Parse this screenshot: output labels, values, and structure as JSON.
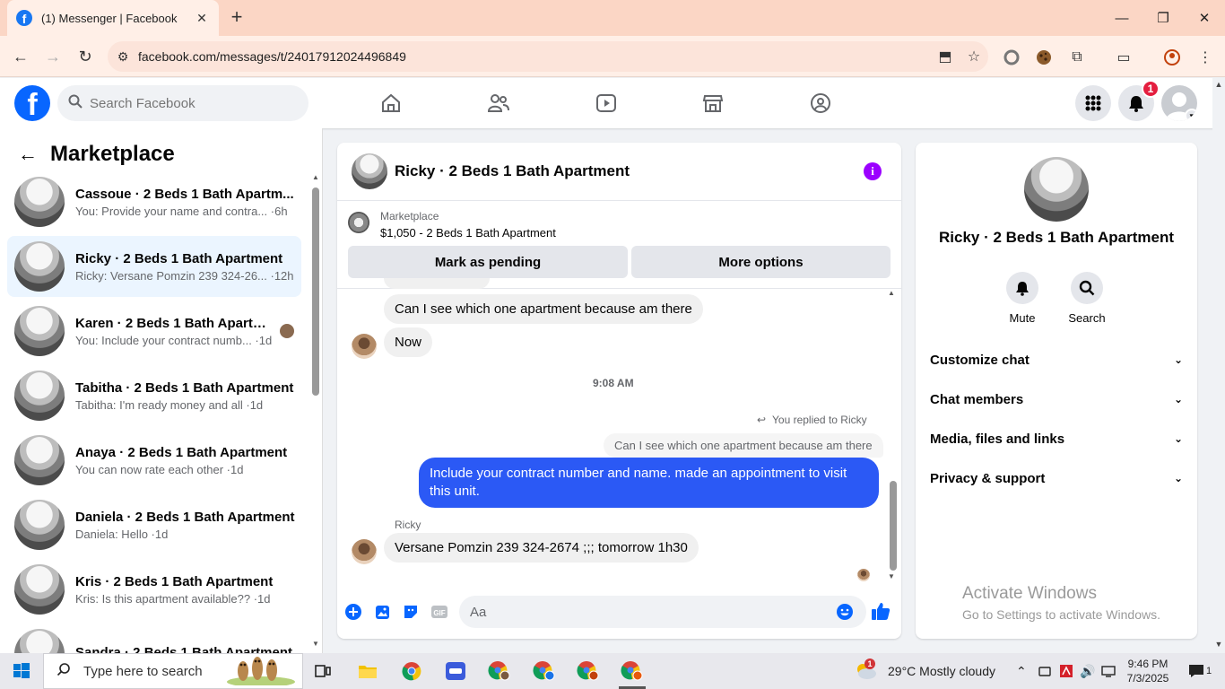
{
  "browser": {
    "tab_title": "(1) Messenger | Facebook",
    "url": "facebook.com/messages/t/24017912024496849",
    "tab_favicon": "f"
  },
  "fb": {
    "search_placeholder": "Search Facebook",
    "notif_count": "1",
    "logo": "f"
  },
  "sidebar": {
    "title": "Marketplace",
    "conversations": [
      {
        "name": "Cassoue · 2 Beds 1 Bath Apartm...",
        "preview": "You: Provide your name and contra... ·6h"
      },
      {
        "name": "Ricky · 2 Beds 1 Bath Apartment",
        "preview": "Ricky: Versane Pomzin 239 324-26... ·12h"
      },
      {
        "name": "Karen · 2 Beds 1 Bath Apartm...",
        "preview": "You: Include your contract numb... ·1d"
      },
      {
        "name": "Tabitha · 2 Beds 1 Bath Apartment",
        "preview": "Tabitha: I'm ready money and all ·1d"
      },
      {
        "name": "Anaya · 2 Beds 1 Bath Apartment",
        "preview": "You can now rate each other ·1d"
      },
      {
        "name": "Daniela · 2 Beds 1 Bath Apartment",
        "preview": "Daniela: Hello ·1d"
      },
      {
        "name": "Kris · 2 Beds 1 Bath Apartment",
        "preview": "Kris: Is this apartment available?? ·1d"
      },
      {
        "name": "Sandra · 2 Beds 1 Bath Apartment",
        "preview": ""
      }
    ]
  },
  "chat": {
    "title": "Ricky · 2 Beds 1 Bath Apartment",
    "listing_source": "Marketplace",
    "listing_title": "$1,050 - 2 Beds 1 Bath Apartment",
    "mark_pending": "Mark as pending",
    "more_options": "More options",
    "messages": {
      "m1": "Can I see which one apartment because am there",
      "m2": "Now",
      "timestamp": "9:08 AM",
      "replied_label": "You replied to Ricky",
      "quoted": "Can I see which one apartment because am there",
      "outgoing": "Include your contract number and name.  made an appointment to visit this unit.",
      "sender": "Ricky",
      "m3": "Versane Pomzin 239 324-2674  ;;; tomorrow 1h30"
    },
    "composer_placeholder": "Aa",
    "gif_label": "GIF"
  },
  "info": {
    "name": "Ricky · 2 Beds 1 Bath Apartment",
    "mute": "Mute",
    "search": "Search",
    "sections": [
      "Customize chat",
      "Chat members",
      "Media, files and links",
      "Privacy & support"
    ],
    "watermark_title": "Activate Windows",
    "watermark_sub": "Go to Settings to activate Windows."
  },
  "taskbar": {
    "search_placeholder": "Type here to search",
    "weather_alert": "1",
    "weather": "29°C  Mostly cloudy",
    "time": "9:46 PM",
    "date": "7/3/2025",
    "notif_count": "1"
  },
  "colors": {
    "brand": "#0866ff",
    "outgoing_bubble": "#2b59f5",
    "info_accent": "#9b00ff",
    "badge": "#e41e3f"
  }
}
